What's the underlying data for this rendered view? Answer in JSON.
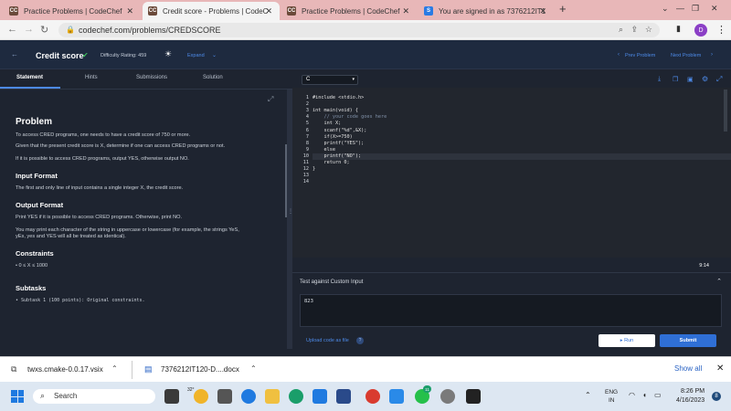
{
  "browser": {
    "tabs": [
      {
        "label": "Practice Problems | CodeChef",
        "favicon": "CC"
      },
      {
        "label": "Credit score - Problems | CodeC",
        "favicon": "CC"
      },
      {
        "label": "Practice Problems | CodeChef",
        "favicon": "CC"
      },
      {
        "label": "You are signed in as 7376212IT1",
        "favicon": "S"
      }
    ],
    "new_tab": "+",
    "url": "codechef.com/problems/CREDSCORE",
    "profile_initial": "D"
  },
  "header": {
    "title": "Credit score",
    "difficulty": "Difficulty Rating: 459",
    "expand": "Expand",
    "prev": "Prev Problem",
    "next": "Next Problem"
  },
  "subnav": {
    "tabs": [
      "Statement",
      "Hints",
      "Submissions",
      "Solution"
    ]
  },
  "problem": {
    "heading": "Problem",
    "p1": "To access CRED programs, one needs to have a credit score of 750 or more.",
    "p2": "Given that the present credit score is X, determine if one can access CRED programs or not.",
    "p3": "If it is possible to access CRED programs, output YES, otherwise output NO.",
    "input_heading": "Input Format",
    "input_text": "The first and only line of input contains a single integer X, the credit score.",
    "output_heading": "Output Format",
    "output_text": "Print YES if it is possible to access CRED programs. Otherwise, print NO.",
    "case_text1": "You may print each character of the string in uppercase or lowercase (for example, the strings YeS,",
    "case_text2": "yEs, yes and YES will all be treated as identical).",
    "constraints_heading": "Constraints",
    "constraint": "0 ≤ X ≤ 1000",
    "subtasks_heading": "Subtasks",
    "subtask": "Subtask 1 (100 points): Original constraints."
  },
  "editor": {
    "language": "C",
    "lines": [
      "#include <stdio.h>",
      "",
      "int main(void) {",
      "    // your code goes here",
      "    int X;",
      "    scanf(\"%d\",&X);",
      "    if(X>=750)",
      "    printf(\"YES\");",
      "    else",
      "    printf(\"NO\");",
      "    return 0;",
      "}",
      "",
      ""
    ],
    "line_numbers": [
      "1",
      "2",
      "3",
      "4",
      "5",
      "6",
      "7",
      "8",
      "9",
      "10",
      "11",
      "12",
      "13",
      "14"
    ],
    "cursor_pos": "9:14"
  },
  "console": {
    "label": "Test against Custom Input",
    "input_value": "823",
    "upload_label": "Upload code as file",
    "run_label": "Run",
    "submit_label": "Submit"
  },
  "downloads": {
    "items": [
      "twxs.cmake-0.0.17.vsix",
      "7376212IT120-D....docx"
    ],
    "show_all": "Show all"
  },
  "taskbar": {
    "search": "Search",
    "weather": "32°",
    "lang1": "ENG",
    "lang2": "IN",
    "time": "8:26 PM",
    "date": "4/16/2023",
    "notif_count": "8",
    "badge_count": "11"
  },
  "colors": {
    "accent_blue": "#2f6fd6",
    "cc_header": "#1e2a3f",
    "tabstrip": "#e8b7b8"
  }
}
